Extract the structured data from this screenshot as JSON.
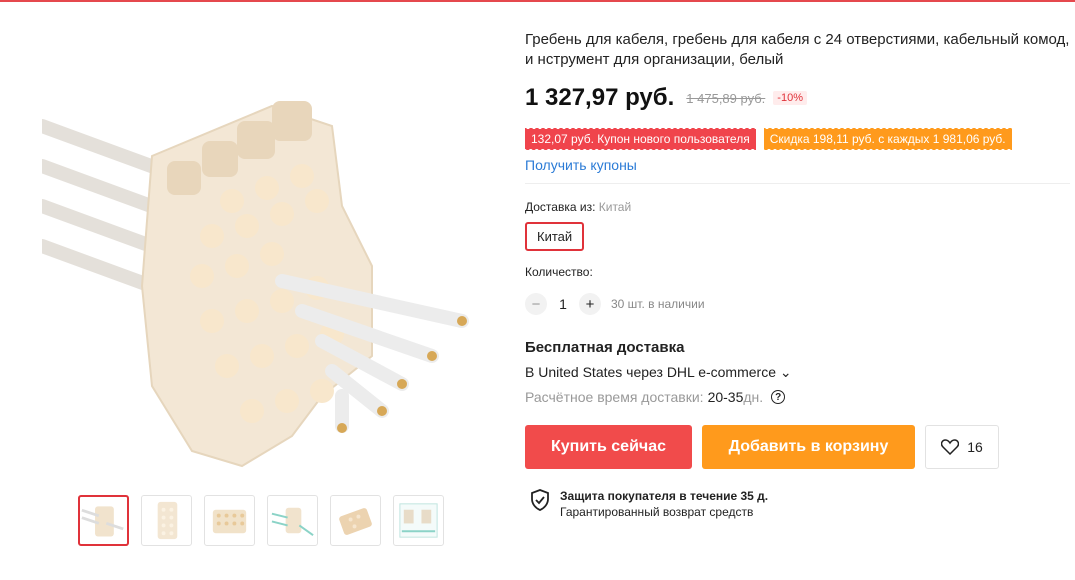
{
  "product": {
    "title": "Гребень для кабеля, гребень для кабеля с 24 отверстиями, кабельный комод, и нструмент для организации, белый",
    "price": "1 327,97 руб.",
    "old_price": "1 475,89 руб.",
    "discount": "-10%"
  },
  "coupons": {
    "new_user": "132,07 руб. Купон нового пользователя",
    "spend_discount": "Скидка 198,11 руб. с каждых 1 981,06 руб.",
    "get_link": "Получить купоны"
  },
  "shipping_from": {
    "label": "Доставка из:",
    "value": "Китай",
    "option": "Китай"
  },
  "quantity": {
    "label": "Количество:",
    "minus": "−",
    "value": "1",
    "plus": "+",
    "stock": "30 шт. в наличии"
  },
  "delivery": {
    "title": "Бесплатная доставка",
    "method": "В United States через DHL e-commerce",
    "chevron": "⌄",
    "time_label": "Расчётное время доставки:",
    "time_value": "20-35",
    "time_unit": "дн.",
    "help": "?"
  },
  "actions": {
    "buy_now": "Купить сейчас",
    "add_to_cart": "Добавить в корзину",
    "wishlist_count": "16"
  },
  "protection": {
    "title": "Защита покупателя в течение 35 д.",
    "subtitle": "Гарантированный возврат средств"
  },
  "colors": {
    "accent_red": "#f14b4b",
    "accent_orange": "#ff9a1c",
    "link_blue": "#2b7bd6"
  }
}
